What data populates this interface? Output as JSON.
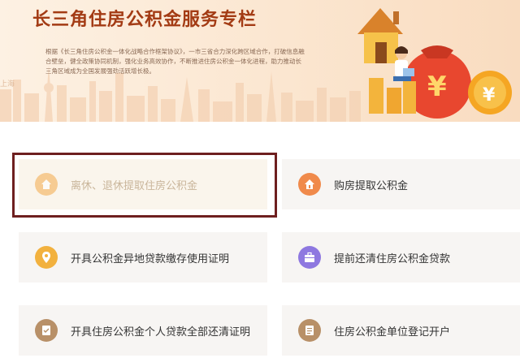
{
  "banner": {
    "title": "长三角住房公积金服务专栏",
    "description": "根据《长三角住房公积金一体化战略合作框架协议》，一市三省合力深化跨区域合作，打破信息融合壁垒，健全政策协同机制，强化业务高效协作，不断推进住房公积金一体化进程，助力推动长三角区域成为全国发展强劲活跃增长极。",
    "city_label": "上海"
  },
  "services": [
    {
      "label": "离休、退休提取住房公积金",
      "icon": "elderly-house-icon",
      "color": "#f3a94a",
      "selected": true
    },
    {
      "label": "购房提取公积金",
      "icon": "house-money-icon",
      "color": "#f08a4b",
      "selected": false
    },
    {
      "label": "开具公积金异地贷款缴存使用证明",
      "icon": "location-pin-icon",
      "color": "#f2b13e",
      "selected": false
    },
    {
      "label": "提前还清住房公积金贷款",
      "icon": "briefcase-icon",
      "color": "#8e78e0",
      "selected": false
    },
    {
      "label": "开具住房公积金个人贷款全部还清证明",
      "icon": "certificate-icon",
      "color": "#b89068",
      "selected": false
    },
    {
      "label": "住房公积金单位登记开户",
      "icon": "document-icon",
      "color": "#b89068",
      "selected": false
    }
  ]
}
